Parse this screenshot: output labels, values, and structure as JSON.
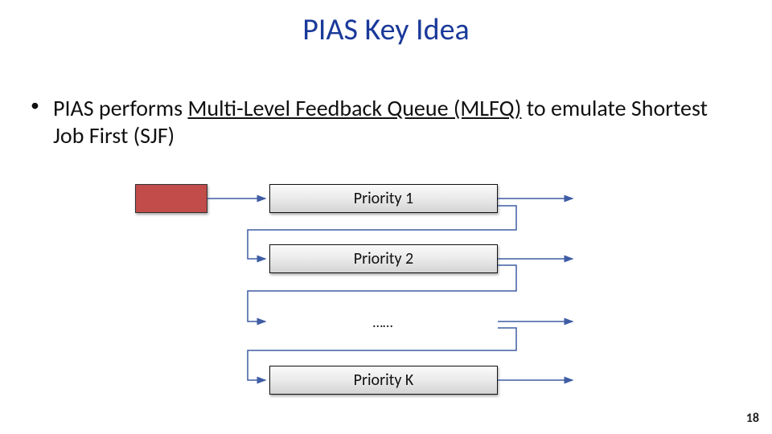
{
  "title": "PIAS Key Idea",
  "bullet_prefix": "PIAS performs ",
  "bullet_underlined": "Multi-Level Feedback Queue (MLFQ)",
  "bullet_suffix": " to emulate Shortest Job First (SJF)",
  "queues": {
    "p1": "Priority 1",
    "p2": "Priority 2",
    "dots": "……",
    "pk": "Priority K"
  },
  "page_number": "18"
}
